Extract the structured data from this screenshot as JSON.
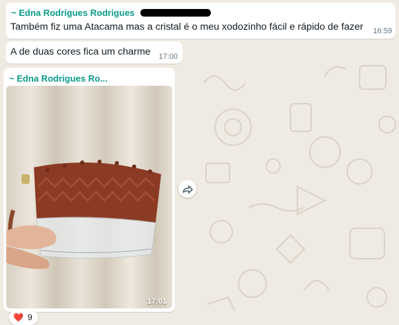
{
  "messages": [
    {
      "sender": "~ Edna Rodrigues Rodrigues",
      "text": "Também fiz uma Atacama mas a cristal é o meu xodozinho fácil e rápido de fazer",
      "time": "16:59"
    },
    {
      "text": "A de duas cores fica um charme",
      "time": "17:00"
    },
    {
      "sender": "~ Edna Rodrigues Ro...",
      "image": "photo of a rust-colored macramé bag with clear transparent bottom held in a hand",
      "time": "17:01"
    }
  ],
  "reaction": {
    "emoji": "❤️",
    "count": "9"
  },
  "icons": {
    "forward": "forward-icon",
    "heart": "heart-icon"
  },
  "colors": {
    "background": "#efeae2",
    "sender": "#0b9b8a",
    "bubble": "#ffffff"
  }
}
